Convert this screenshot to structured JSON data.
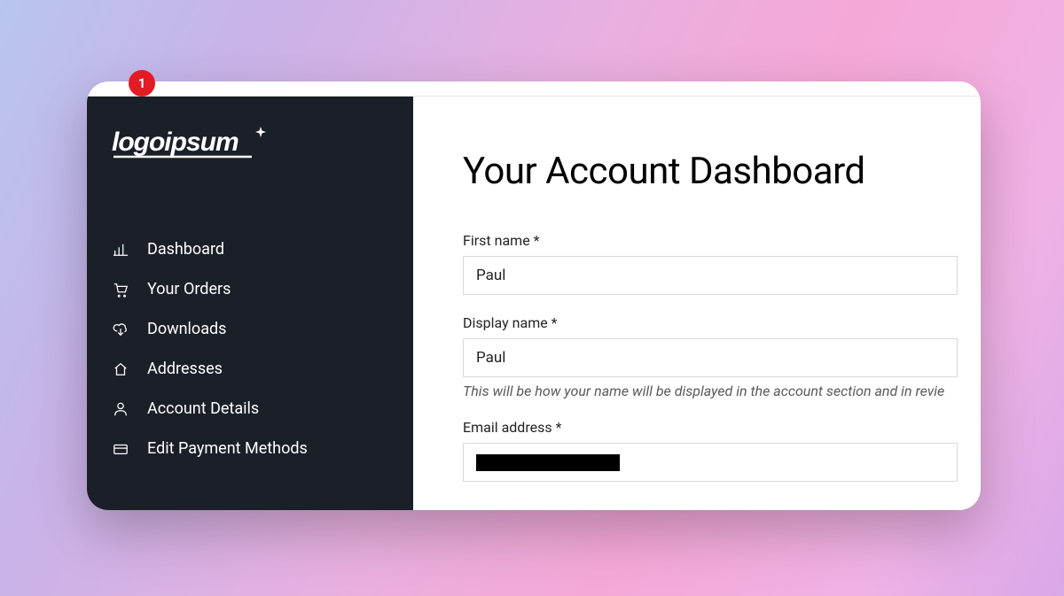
{
  "badge": "1",
  "logo_text": "logoipsum",
  "sidebar": {
    "items": [
      {
        "label": "Dashboard",
        "icon": "chart"
      },
      {
        "label": "Your Orders",
        "icon": "cart"
      },
      {
        "label": "Downloads",
        "icon": "cloud"
      },
      {
        "label": "Addresses",
        "icon": "home"
      },
      {
        "label": "Account Details",
        "icon": "user"
      },
      {
        "label": "Edit Payment Methods",
        "icon": "card"
      }
    ]
  },
  "main": {
    "title": "Your Account Dashboard",
    "fields": {
      "first_name": {
        "label": "First name *",
        "value": "Paul"
      },
      "display_name": {
        "label": "Display name *",
        "value": "Paul",
        "help": "This will be how your name will be displayed in the account section and in revie"
      },
      "email": {
        "label": "Email address *",
        "value": ""
      }
    }
  }
}
